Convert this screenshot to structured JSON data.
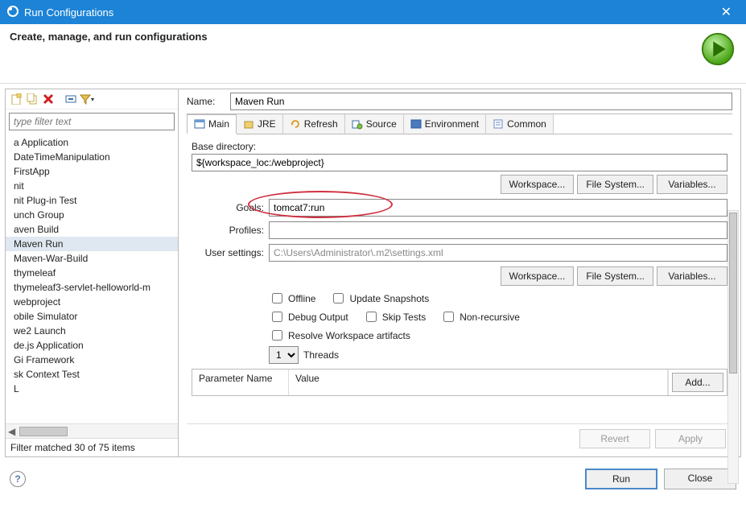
{
  "title": "Run Configurations",
  "heading": "Create, manage, and run configurations",
  "filter": {
    "placeholder": "type filter text"
  },
  "configs": [
    "a Application",
    "DateTimeManipulation",
    "FirstApp",
    "nit",
    "nit Plug-in Test",
    "unch Group",
    "aven Build",
    "Maven Run",
    "Maven-War-Build",
    "thymeleaf",
    "thymeleaf3-servlet-helloworld-m",
    "webproject",
    "obile Simulator",
    "we2 Launch",
    "de.js Application",
    "Gi Framework",
    "sk Context Test",
    "L"
  ],
  "selected_config_index": 7,
  "filter_status": "Filter matched 30 of 75 items",
  "name_label": "Name:",
  "name_value": "Maven Run",
  "tabs": [
    {
      "label": "Main"
    },
    {
      "label": "JRE"
    },
    {
      "label": "Refresh"
    },
    {
      "label": "Source"
    },
    {
      "label": "Environment"
    },
    {
      "label": "Common"
    }
  ],
  "form": {
    "base_dir_label": "Base directory:",
    "base_dir_value": "${workspace_loc:/webproject}",
    "btn_workspace": "Workspace...",
    "btn_filesystem": "File System...",
    "btn_variables": "Variables...",
    "goals_label": "Goals:",
    "goals_value": "tomcat7:run",
    "profiles_label": "Profiles:",
    "profiles_value": "",
    "usersettings_label": "User settings:",
    "usersettings_value": "C:\\Users\\Administrator\\.m2\\settings.xml",
    "cb_offline": "Offline",
    "cb_update": "Update Snapshots",
    "cb_debug": "Debug Output",
    "cb_skiptests": "Skip Tests",
    "cb_nonrecursive": "Non-recursive",
    "cb_resolve": "Resolve Workspace artifacts",
    "threads_value": "1",
    "threads_label": "Threads",
    "param_name_col": "Parameter Name",
    "param_value_col": "Value",
    "btn_add": "Add..."
  },
  "btn_revert": "Revert",
  "btn_apply": "Apply",
  "btn_run": "Run",
  "btn_close": "Close"
}
